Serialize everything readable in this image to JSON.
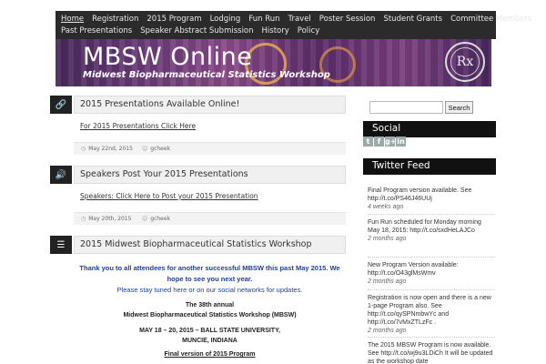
{
  "nav": {
    "row1": [
      "Home",
      "Registration",
      "2015 Program",
      "Lodging",
      "Fun Run",
      "Travel",
      "Poster Session",
      "Student Grants",
      "Committee Members"
    ],
    "row2": [
      "Past Presentations",
      "Speaker Abstract Submission",
      "History",
      "Policy"
    ]
  },
  "banner": {
    "title": "MBSW Online",
    "subtitle": "Midwest Biopharmaceutical Statistics Workshop",
    "seal": "Rx"
  },
  "posts": [
    {
      "icon": "link-icon",
      "title": "2015 Presentations Available Online!",
      "link": "For 2015 Presentations Click Here",
      "date": "May 22nd, 2015",
      "author": "gcheek"
    },
    {
      "icon": "speaker-icon",
      "title": "Speakers Post Your 2015 Presentations",
      "link": "Speakers: Click Here to Post your 2015 Presentation",
      "date": "May 20th, 2015",
      "author": "gcheek"
    },
    {
      "icon": "document-icon",
      "title": "2015 Midwest Biopharmaceutical Statistics Workshop"
    }
  ],
  "workshop": {
    "line1": "Thank you to all attendees for another successful MBSW this past May 2015. We",
    "line2": "hope to see you next year.",
    "line3": "Please stay tuned here or on our social networks for updates.",
    "annual": "The 38th annual",
    "name": "Midwest Biopharmaceutical Statistics Workshop (MBSW)",
    "dates": "MAY 18 – 20, 2015 – BALL STATE UNIVERSITY,",
    "place": "MUNCIE, INDIANA",
    "final": "Final version of 2015 Program"
  },
  "sidebar": {
    "search_button": "Search",
    "social_title": "Social",
    "social_icons": [
      "twitter-icon",
      "facebook-icon",
      "google-plus-icon",
      "linkedin-icon"
    ],
    "social_glyphs": [
      "t",
      "f",
      "g+",
      "in"
    ],
    "twitter_title": "Twitter Feed",
    "tweets": [
      {
        "text": "Final Program version available. See http://t.co/PS46J46UUj",
        "age": "4 weeks ago"
      },
      {
        "text": "Fun Run scheduled for Monday morning May 18, 2015: http://t.co/sxdHeLAJCo",
        "age": "2 months ago"
      },
      {
        "text": "New Program Version available: http://t.co/O43glMsWmv",
        "age": "2 months ago"
      },
      {
        "text": "Registration is now open and there is a new 1-page Program also. See http://t.co/qySPNmbwYc and http://t.co/7vMxZTLzFc .",
        "age": "2 months ago"
      },
      {
        "text": "The 2015 MBSW Program is now available. See http://t.co/wj9u3LDiCh It will be updated as the workshop date",
        "age": ""
      }
    ]
  }
}
